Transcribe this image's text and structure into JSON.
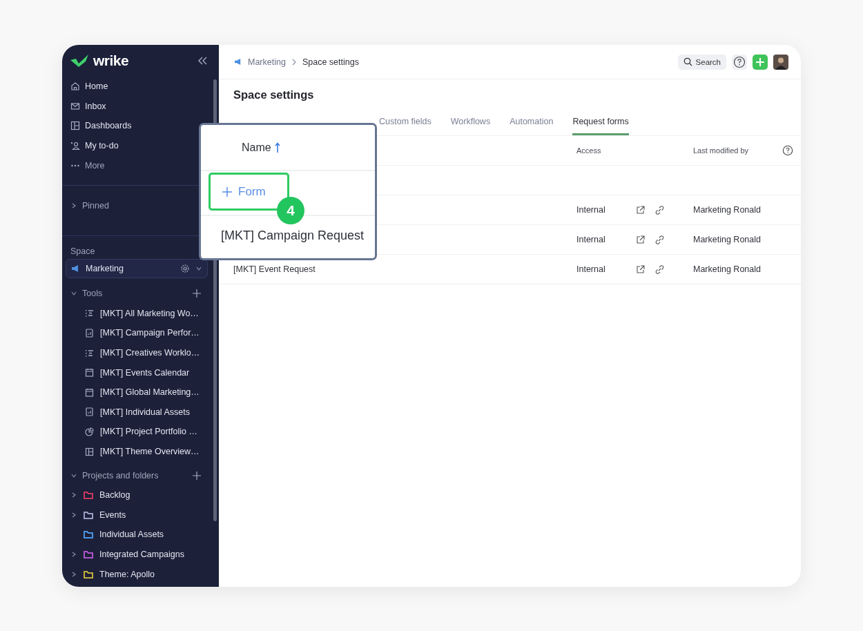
{
  "brand": {
    "name": "wrike"
  },
  "nav": [
    {
      "label": "Home",
      "kind": "home"
    },
    {
      "label": "Inbox",
      "kind": "mail"
    },
    {
      "label": "Dashboards",
      "kind": "dashboard"
    },
    {
      "label": "My to-do",
      "kind": "person"
    },
    {
      "label": "More",
      "kind": "dots"
    }
  ],
  "pinned": {
    "label": "Pinned",
    "expanded": false
  },
  "space": {
    "heading": "Space",
    "name": "Marketing",
    "selected": true
  },
  "tools": {
    "label": "Tools",
    "expanded": true,
    "items": [
      {
        "label": "[MKT] All Marketing Wo…",
        "kind": "workload"
      },
      {
        "label": "[MKT] Campaign Perfor…",
        "kind": "report"
      },
      {
        "label": "[MKT] Creatives Worklo…",
        "kind": "workload"
      },
      {
        "label": "[MKT] Events Calendar",
        "kind": "calendar"
      },
      {
        "label": "[MKT] Global Marketing…",
        "kind": "calendar"
      },
      {
        "label": "[MKT] Individual Assets",
        "kind": "report"
      },
      {
        "label": "[MKT] Project Portfolio …",
        "kind": "pie"
      },
      {
        "label": "[MKT] Theme Overview…",
        "kind": "dashboard"
      }
    ]
  },
  "projects": {
    "label": "Projects and folders",
    "expanded": true,
    "items": [
      {
        "label": "Backlog",
        "color": "#c8385c",
        "expandable": true
      },
      {
        "label": "Events",
        "color": "#9a9fc4",
        "expandable": true
      },
      {
        "label": "Individual Assets",
        "color": "#4d94e0",
        "expandable": false
      },
      {
        "label": "Integrated Campaigns",
        "color": "#b052cc",
        "expandable": true
      },
      {
        "label": "Theme: Apollo",
        "color": "#c2ad3a",
        "expandable": true
      }
    ]
  },
  "breadcrumb": [
    "Marketing",
    "Space settings"
  ],
  "search": {
    "label": "Search"
  },
  "title": "Space settings",
  "tabs": [
    {
      "label": "Custom fields",
      "selected": false
    },
    {
      "label": "Workflows",
      "selected": false
    },
    {
      "label": "Automation",
      "selected": false
    },
    {
      "label": "Request forms",
      "selected": true
    }
  ],
  "table": {
    "columns": [
      "Access",
      "Last modified by"
    ],
    "rows": [
      {
        "access": "Internal",
        "modified_by": "Marketing Ronald"
      },
      {
        "access": "Internal",
        "modified_by": "Marketing Ronald"
      },
      {
        "name": "[MKT] Event Request",
        "access": "Internal",
        "modified_by": "Marketing Ronald"
      }
    ]
  },
  "callout": {
    "header": "Name",
    "add_label": "Form",
    "row": "[MKT] Campaign Request",
    "step": "4"
  }
}
